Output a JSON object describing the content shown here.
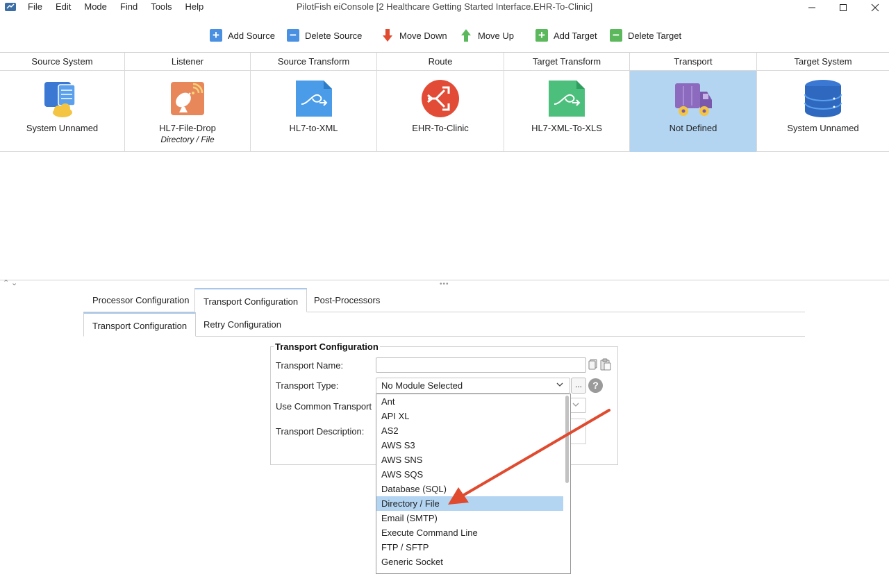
{
  "window": {
    "title": "PilotFish eiConsole [2 Healthcare Getting Started Interface.EHR-To-Clinic]",
    "menu": [
      "File",
      "Edit",
      "Mode",
      "Find",
      "Tools",
      "Help"
    ],
    "controls": [
      "minimize-icon",
      "maximize-icon",
      "close-icon"
    ]
  },
  "toolbar": {
    "add_source": "Add Source",
    "delete_source": "Delete Source",
    "move_down": "Move Down",
    "move_up": "Move Up",
    "add_target": "Add Target",
    "delete_target": "Delete Target"
  },
  "stages": [
    {
      "header": "Source System",
      "name": "System Unnamed",
      "sub": "",
      "icon": "source-system-icon",
      "selected": false
    },
    {
      "header": "Listener",
      "name": "HL7-File-Drop",
      "sub": "Directory / File",
      "icon": "satellite-dish-icon",
      "selected": false
    },
    {
      "header": "Source Transform",
      "name": "HL7-to-XML",
      "sub": "",
      "icon": "transform-document-icon",
      "selected": false
    },
    {
      "header": "Route",
      "name": "EHR-To-Clinic",
      "sub": "",
      "icon": "route-icon",
      "selected": false
    },
    {
      "header": "Target Transform",
      "name": "HL7-XML-To-XLS",
      "sub": "",
      "icon": "transform-document-icon",
      "selected": false
    },
    {
      "header": "Transport",
      "name": "Not Defined",
      "sub": "",
      "icon": "truck-icon",
      "selected": true
    },
    {
      "header": "Target System",
      "name": "System Unnamed",
      "sub": "",
      "icon": "database-icon",
      "selected": false
    }
  ],
  "tabs": [
    "Processor Configuration",
    "Transport Configuration",
    "Post-Processors"
  ],
  "active_tab": "Transport Configuration",
  "subtabs": [
    "Transport Configuration",
    "Retry Configuration"
  ],
  "active_subtab": "Transport Configuration",
  "form": {
    "title": "Transport Configuration",
    "name_label": "Transport Name:",
    "name_value": "",
    "type_label": "Transport Type:",
    "type_value": "No Module Selected",
    "common_label": "Use Common Transport",
    "desc_label": "Transport Description:",
    "ellipsis": "...",
    "help": "?"
  },
  "dropdown": {
    "options": [
      "Ant",
      "API XL",
      "AS2",
      "AWS S3",
      "AWS SNS",
      "AWS SQS",
      "Database (SQL)",
      "Directory / File",
      "Email (SMTP)",
      "Execute Command Line",
      "FTP / SFTP",
      "Generic Socket"
    ],
    "highlighted": "Directory / File"
  },
  "colors": {
    "selection": "#b3d5f2",
    "add_green": "#5cb85c",
    "blue_square": "#4a90e2",
    "move_down_red": "#e04a2f",
    "move_up_green": "#5cb85c",
    "annotation_arrow": "#e04a2f"
  }
}
